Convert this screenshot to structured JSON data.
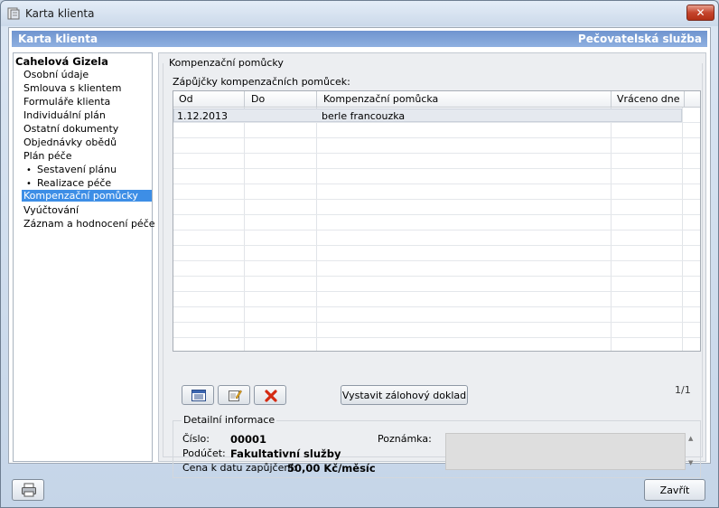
{
  "window": {
    "title": "Karta klienta",
    "close_glyph": "✕"
  },
  "banner": {
    "left": "Karta klienta",
    "right": "Pečovatelská služba"
  },
  "nav": {
    "client_name": "Cahelová Gizela",
    "items": [
      {
        "label": "Osobní údaje"
      },
      {
        "label": "Smlouva s klientem"
      },
      {
        "label": "Formuláře klienta"
      },
      {
        "label": "Individuální plán"
      },
      {
        "label": "Ostatní dokumenty"
      },
      {
        "label": "Objednávky obědů"
      },
      {
        "label": "Plán péče"
      },
      {
        "label": "Sestavení plánu",
        "sub": true
      },
      {
        "label": "Realizace péče",
        "sub": true
      },
      {
        "label": "Kompenzační pomůcky",
        "selected": true
      },
      {
        "label": "Vyúčtování"
      },
      {
        "label": "Záznam a hodnocení péče"
      }
    ],
    "bullet": "•"
  },
  "section": {
    "title": "Kompenzační pomůcky",
    "grid_label": "Zápůjčky kompenzačních pomůcek:",
    "columns": [
      "Od",
      "Do",
      "Kompenzační pomůcka",
      "Vráceno dne"
    ],
    "rows": [
      {
        "od": "1.12.2013",
        "do": "",
        "pomucka": "berle francouzka",
        "vraceno": ""
      }
    ],
    "buttons": {
      "list_icon": "list-icon",
      "edit_icon": "edit-icon",
      "delete_icon": "delete-icon",
      "deposit_label": "Vystavit zálohový doklad"
    },
    "pager": "1/1"
  },
  "detail": {
    "title": "Detailní informace",
    "cislo_label": "Číslo:",
    "cislo_value": "00001",
    "producet_label": "Podúčet:",
    "producet_value": "Fakultativní služby",
    "cena_label": "Cena k datu zapůjčení:",
    "cena_value": "50,00 Kč/měsíc",
    "poznamka_label": "Poznámka:",
    "scroll_up": "▲",
    "scroll_down": "▼"
  },
  "footer": {
    "print_icon": "printer-icon",
    "close_label": "Zavřít"
  },
  "colors": {
    "banner": "#7fa2d8",
    "selected": "#3d8ee6",
    "delete": "#d42a12"
  }
}
